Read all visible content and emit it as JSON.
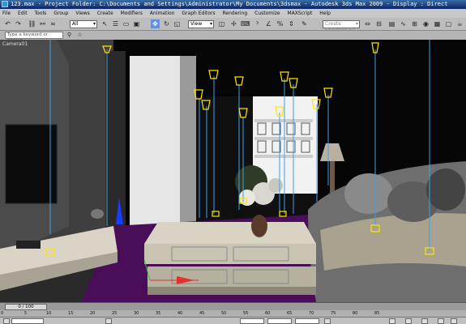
{
  "window": {
    "title": "123.max   - Project Folder: C:\\Documents and Settings\\Administrator\\My Documents\\3dsmax   - Autodesk 3ds Max  2009      - Display : Direct"
  },
  "menu": {
    "items": [
      "File",
      "Edit",
      "Tools",
      "Group",
      "Views",
      "Create",
      "Modifiers",
      "Animation",
      "Graph Editors",
      "Rendering",
      "Customize",
      "MAXScript",
      "Help"
    ]
  },
  "toolbar": {
    "selection_filter": "All",
    "reference_coord": "View",
    "named_selection": "Create Selection Se"
  },
  "search": {
    "placeholder": "Type a keyword or phrase"
  },
  "viewport": {
    "label": "Camera01"
  },
  "timeline": {
    "frame_display": "0 / 100",
    "ticks": [
      "0",
      "5",
      "10",
      "15",
      "20",
      "25",
      "30",
      "35",
      "40",
      "45",
      "50",
      "55",
      "60",
      "65",
      "70",
      "75",
      "80",
      "85"
    ]
  },
  "colors": {
    "floor_carpet": "#4a0d57",
    "light_gizmo": "#ffe600",
    "target_line": "#3fa0e8",
    "menubar_bg": "#c8c8c8"
  }
}
